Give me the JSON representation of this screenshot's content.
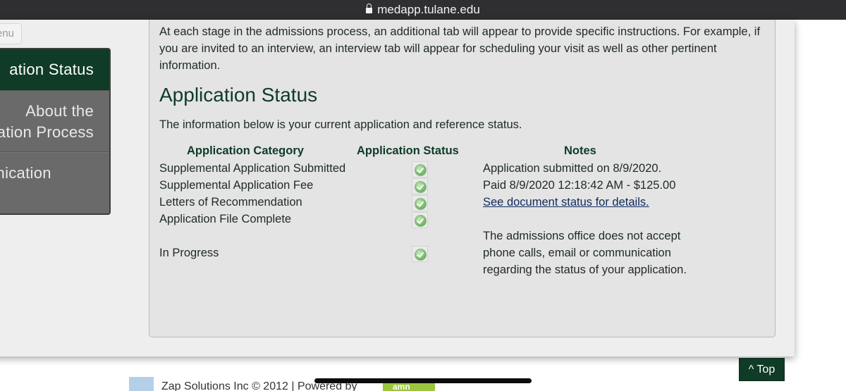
{
  "browser": {
    "url": "medapp.tulane.edu"
  },
  "sidebar": {
    "menu_tab_label": "enu",
    "items": [
      {
        "label": "ation Status"
      },
      {
        "label_line1": "About the",
        "label_line2": "ation Process"
      },
      {
        "label": "unication"
      }
    ]
  },
  "main": {
    "intro": "At each stage in the admissions process, an additional tab will appear to provide specific instructions. For example, if you are invited to an interview, an interview tab will appear for scheduling your visit as well as other pertinent information.",
    "heading": "Application Status",
    "subheading": "The information below is your current application and reference status.",
    "table": {
      "headers": [
        "Application Category",
        "Application Status",
        "Notes"
      ],
      "rows": [
        {
          "category": "Supplemental Application Submitted",
          "status_icon": "check-icon",
          "note": "Application submitted on 8/9/2020."
        },
        {
          "category": "Supplemental Application Fee",
          "status_icon": "check-icon",
          "note": "Paid 8/9/2020 12:18:42 AM - $125.00"
        },
        {
          "category": "Letters of Recommendation",
          "status_icon": "check-icon",
          "note": "See document status for details."
        },
        {
          "category": "Application File Complete",
          "status_icon": "check-icon",
          "note": ""
        },
        {
          "category": "In Progress",
          "status_icon": "check-icon",
          "note": ""
        }
      ],
      "notice": [
        "The admissions office does not accept",
        "phone calls, email or communication",
        "regarding the status of your application."
      ]
    }
  },
  "footer": {
    "top_button": "^ Top",
    "copyright": "Zap Solutions Inc © 2012 | Powered by",
    "badge": "amn"
  },
  "colors": {
    "brand_green": "#0f3b27",
    "check_green": "#79b86e"
  }
}
